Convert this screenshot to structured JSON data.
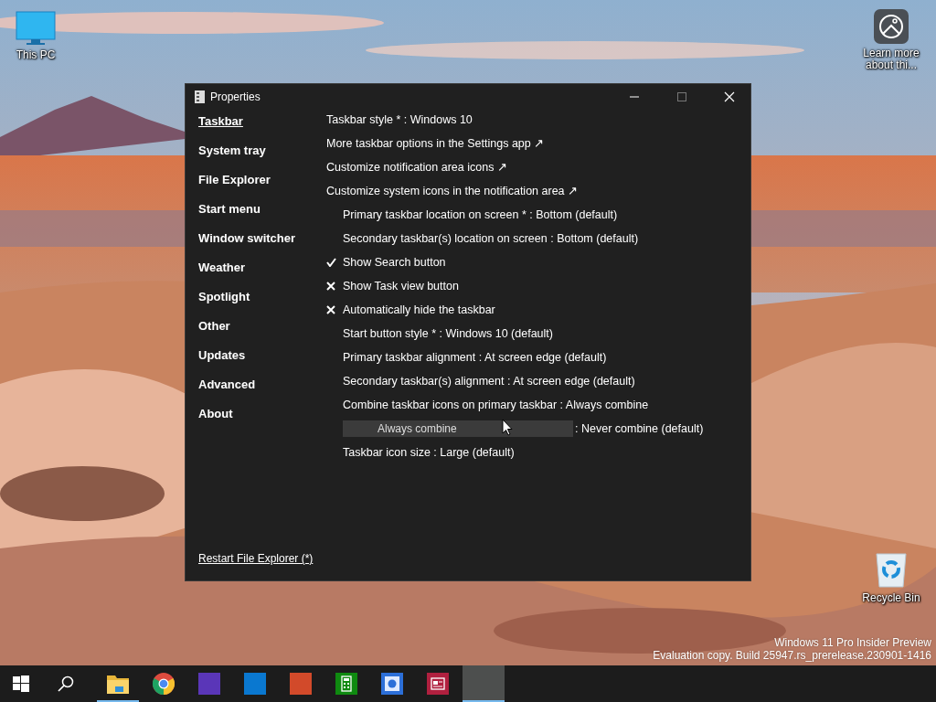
{
  "desktop_icons": [
    {
      "kind": "computer",
      "label": "This PC"
    },
    {
      "kind": "spotlight",
      "label": "Learn more about thi..."
    },
    {
      "kind": "recycle",
      "label": "Recycle Bin"
    }
  ],
  "window": {
    "title": "Properties",
    "sidebar": [
      {
        "label": "Taskbar",
        "selected": true
      },
      {
        "label": "System tray",
        "selected": false
      },
      {
        "label": "File Explorer",
        "selected": false
      },
      {
        "label": "Start menu",
        "selected": false
      },
      {
        "label": "Window switcher",
        "selected": false
      },
      {
        "label": "Weather",
        "selected": false
      },
      {
        "label": "Spotlight",
        "selected": false
      },
      {
        "label": "Other",
        "selected": false
      },
      {
        "label": "Updates",
        "selected": false
      },
      {
        "label": "Advanced",
        "selected": false
      },
      {
        "label": "About",
        "selected": false
      }
    ],
    "settings": [
      {
        "kind": "plain",
        "label": "Taskbar style * : Windows 10"
      },
      {
        "kind": "link",
        "label": "More taskbar options in the Settings app ↗"
      },
      {
        "kind": "link",
        "label": "Customize notification area icons ↗"
      },
      {
        "kind": "link",
        "label": "Customize system icons in the notification area ↗"
      },
      {
        "kind": "option",
        "label": "Primary taskbar location on screen * : Bottom (default)"
      },
      {
        "kind": "option",
        "label": "Secondary taskbar(s) location on screen : Bottom (default)"
      },
      {
        "kind": "toggle",
        "label": "Show Search button",
        "checked": true
      },
      {
        "kind": "toggle",
        "label": "Show Task view button",
        "checked": false
      },
      {
        "kind": "toggle",
        "label": "Automatically hide the taskbar",
        "checked": false
      },
      {
        "kind": "option",
        "label": "Start button style * : Windows 10 (default)"
      },
      {
        "kind": "option",
        "label": "Primary taskbar alignment : At screen edge (default)"
      },
      {
        "kind": "option",
        "label": "Secondary taskbar(s) alignment : At screen edge (default)"
      },
      {
        "kind": "option",
        "label": "Combine taskbar icons on primary taskbar : Always combine"
      },
      {
        "kind": "option",
        "label": ": Never combine (default)",
        "dragging": true
      },
      {
        "kind": "option",
        "label": "Taskbar icon size : Large (default)"
      }
    ],
    "drag_ghost": "Always combine",
    "footer_link": "Restart File Explorer (*)"
  },
  "build_info": [
    "Windows 11 Pro Insider Preview",
    "Evaluation copy. Build 25947.rs_prerelease.230901-1416"
  ],
  "taskbar": [
    {
      "kind": "start",
      "running": false,
      "selected": false
    },
    {
      "kind": "search",
      "running": false,
      "selected": false
    },
    {
      "kind": "folder",
      "running": true,
      "selected": false
    },
    {
      "kind": "browser",
      "running": false,
      "selected": false
    },
    {
      "kind": "purple-app",
      "running": false,
      "selected": false
    },
    {
      "kind": "blue-app",
      "running": false,
      "selected": false
    },
    {
      "kind": "orange-app",
      "running": false,
      "selected": false
    },
    {
      "kind": "calculator",
      "running": false,
      "selected": false
    },
    {
      "kind": "photo-app",
      "running": false,
      "selected": false
    },
    {
      "kind": "news-app",
      "running": false,
      "selected": false
    },
    {
      "kind": "blank",
      "running": true,
      "selected": true
    }
  ]
}
